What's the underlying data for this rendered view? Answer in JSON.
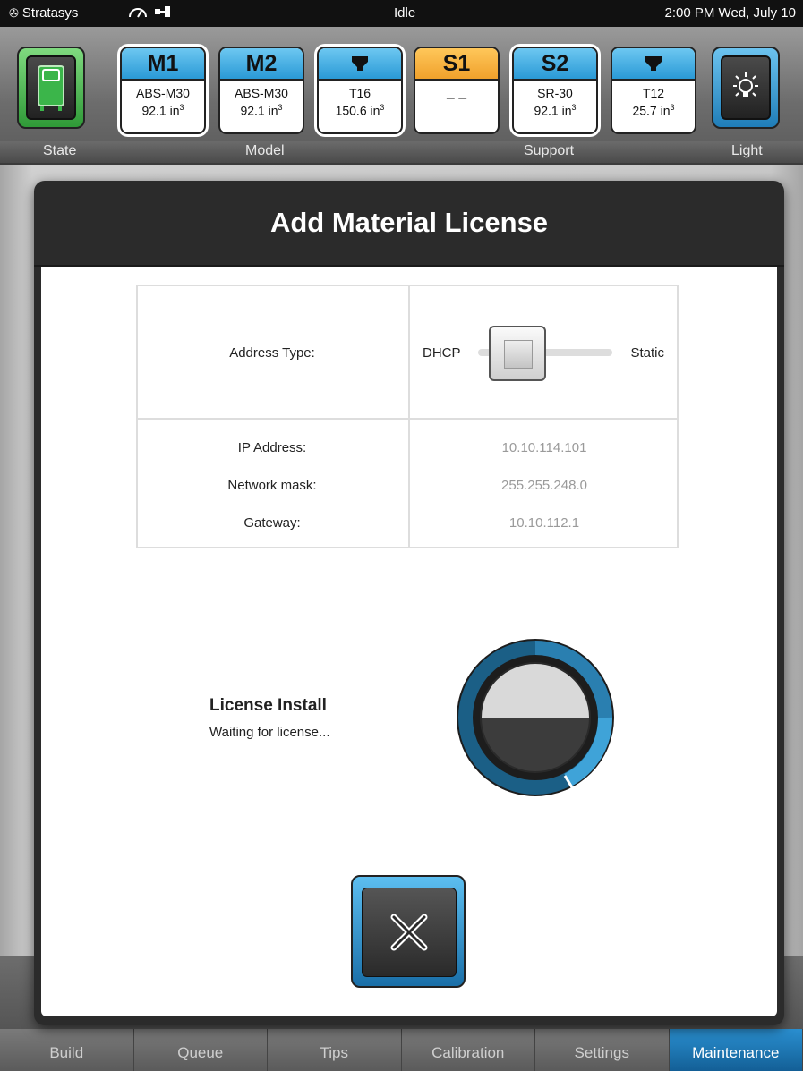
{
  "status_bar": {
    "brand": "Stratasys",
    "state": "Idle",
    "datetime": "2:00 PM Wed, July 10"
  },
  "header": {
    "state_label": "State",
    "model_label": "Model",
    "support_label": "Support",
    "light_label": "Light",
    "bays": [
      {
        "id": "M1",
        "line1": "ABS-M30",
        "line2": "92.1 in",
        "unit_sup": "3",
        "color": "#2a9ad6"
      },
      {
        "id": "M2",
        "line1": "ABS-M30",
        "line2": "92.1 in",
        "unit_sup": "3",
        "color": "#2a9ad6"
      },
      {
        "id": "",
        "line1": "T16",
        "line2": "150.6 in",
        "unit_sup": "3",
        "color": "#2a9ad6",
        "icon": "tip-icon"
      },
      {
        "id": "S1",
        "line1": "– –",
        "line2": "",
        "unit_sup": "",
        "color": "#f0a12c"
      },
      {
        "id": "S2",
        "line1": "SR-30",
        "line2": "92.1 in",
        "unit_sup": "3",
        "color": "#2a9ad6"
      },
      {
        "id": "",
        "line1": "T12",
        "line2": "25.7 in",
        "unit_sup": "3",
        "color": "#2a9ad6",
        "icon": "tip-icon"
      }
    ]
  },
  "modal": {
    "title": "Add Material License",
    "address_type_label": "Address Type:",
    "dhcp_label": "DHCP",
    "static_label": "Static",
    "ip_label": "IP Address:",
    "ip_value": "10.10.114.101",
    "mask_label": "Network mask:",
    "mask_value": "255.255.248.0",
    "gateway_label": "Gateway:",
    "gateway_value": "10.10.112.1",
    "license_title": "License Install",
    "license_status": "Waiting for license..."
  },
  "tabs": [
    {
      "label": "Build"
    },
    {
      "label": "Queue"
    },
    {
      "label": "Tips"
    },
    {
      "label": "Calibration"
    },
    {
      "label": "Settings"
    },
    {
      "label": "Maintenance",
      "active": true
    }
  ],
  "colors": {
    "accent_blue": "#2a9ad6",
    "accent_orange": "#f0a12c",
    "state_green": "#2f9a37"
  }
}
